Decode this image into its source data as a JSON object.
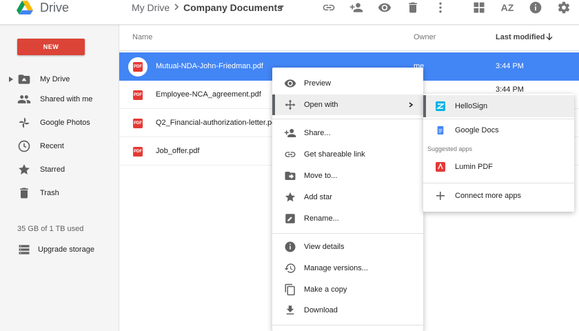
{
  "header": {
    "app_title": "Drive",
    "breadcrumb_root": "My Drive",
    "breadcrumb_current": "Company Documents",
    "sort_icon_text": "AZ",
    "icons": [
      "link-icon",
      "add-person-icon",
      "eye-icon",
      "trash-icon",
      "more-vert-icon",
      "grid-view-icon",
      "sort-az-icon",
      "info-icon",
      "settings-icon"
    ]
  },
  "sidebar": {
    "new_label": "NEW",
    "items": [
      {
        "label": "My Drive",
        "icon": "my-drive-icon"
      },
      {
        "label": "Shared with me",
        "icon": "people-icon"
      },
      {
        "label": "Google Photos",
        "icon": "photos-pinwheel-icon"
      },
      {
        "label": "Recent",
        "icon": "clock-icon"
      },
      {
        "label": "Starred",
        "icon": "star-icon"
      },
      {
        "label": "Trash",
        "icon": "trash-icon"
      }
    ],
    "storage_text": "35 GB of 1 TB used",
    "upgrade_label": "Upgrade storage"
  },
  "file_list": {
    "columns": {
      "name": "Name",
      "owner": "Owner",
      "modified": "Last modified"
    },
    "files": [
      {
        "name": "Mutual-NDA-John-Friedman.pdf",
        "owner": "me",
        "modified": "3:44 PM",
        "selected": true,
        "type_label": "PDF"
      },
      {
        "name": "Employee-NCA_agreement.pdf",
        "owner": "",
        "modified": "3:44 PM",
        "selected": false,
        "type_label": "PDF"
      },
      {
        "name": "Q2_Financial-authorization-letter.pdf",
        "owner": "",
        "modified": "",
        "selected": false,
        "type_label": "PDF"
      },
      {
        "name": "Job_offer.pdf",
        "owner": "",
        "modified": "",
        "selected": false,
        "type_label": "PDF"
      }
    ]
  },
  "context_menu": {
    "items": [
      {
        "label": "Preview",
        "icon": "eye-icon"
      },
      {
        "label": "Open with",
        "icon": "open-with-icon"
      },
      {
        "label": "Share...",
        "icon": "add-person-icon"
      },
      {
        "label": "Get shareable link",
        "icon": "link-icon"
      },
      {
        "label": "Move to...",
        "icon": "move-folder-icon"
      },
      {
        "label": "Add star",
        "icon": "star-icon"
      },
      {
        "label": "Rename...",
        "icon": "edit-icon"
      },
      {
        "label": "View details",
        "icon": "info-icon"
      },
      {
        "label": "Manage versions...",
        "icon": "history-icon"
      },
      {
        "label": "Make a copy",
        "icon": "copy-icon"
      },
      {
        "label": "Download",
        "icon": "download-icon"
      }
    ]
  },
  "open_with_submenu": {
    "apps": [
      {
        "label": "HelloSign",
        "icon": "hellosign-icon",
        "color": "#00b3e6"
      },
      {
        "label": "Google Docs",
        "icon": "google-docs-icon",
        "color": "#4285f4"
      }
    ],
    "suggested_label": "Suggested apps",
    "suggested": [
      {
        "label": "Lumin PDF",
        "icon": "lumin-pdf-icon",
        "color": "#e53935"
      }
    ],
    "connect_label": "Connect more apps"
  },
  "colors": {
    "accent_blue": "#4285f4",
    "new_button_red": "#db4437",
    "sidebar_bg": "#f5f5f5"
  }
}
